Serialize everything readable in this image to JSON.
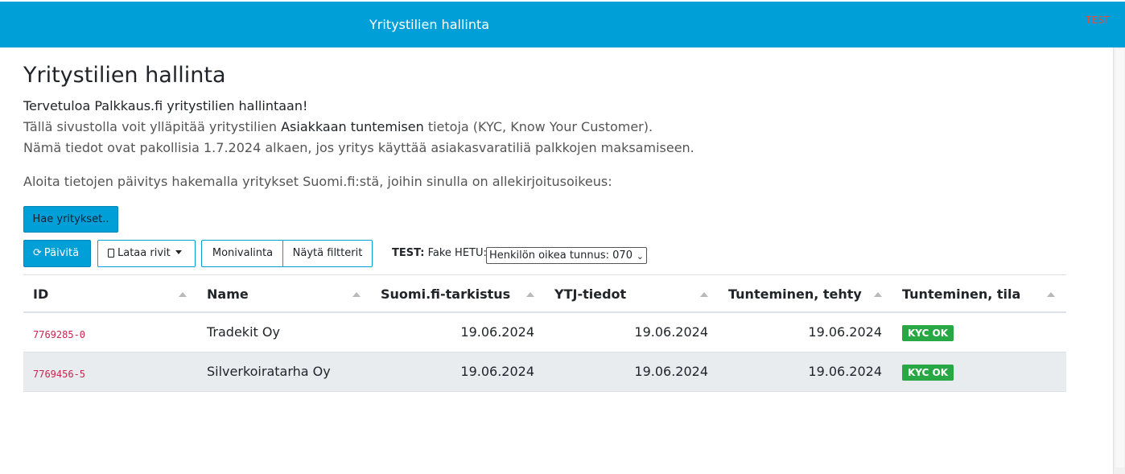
{
  "header": {
    "title": "Yritystilien hallinta",
    "test_label": "TEST"
  },
  "main": {
    "heading": "Yritystilien hallinta",
    "welcome": "Tervetuloa Palkkaus.fi yritystilien hallintaan!",
    "line1_before": "Tällä sivustolla voit ylläpitää yritystilien ",
    "line1_strong": "Asiakkaan tuntemisen",
    "line1_after": " tietoja (KYC, Know Your Customer).",
    "line2": "Nämä tiedot ovat pakollisia 1.7.2024 alkaen, jos yritys käyttää asiakasvaratiliä palkkojen maksamiseen.",
    "line3": "Aloita tietojen päivitys hakemalla yritykset Suomi.fi:stä, joihin sinulla on allekirjoitusoikeus:"
  },
  "toolbar": {
    "search_button": "Hae yritykset..",
    "refresh_button": "Päivitä",
    "download_button": "Lataa rivit",
    "multiselect_button": "Monivalinta",
    "filters_button": "Näytä filtterit",
    "fake_hetu_prefix": "TEST:",
    "fake_hetu_label": "Fake HETU:",
    "fake_hetu_selected": "Henkilön oikea tunnus: 070"
  },
  "table": {
    "columns": [
      "ID",
      "Name",
      "Suomi.fi-tarkistus",
      "YTJ-tiedot",
      "Tunteminen, tehty",
      "Tunteminen, tila"
    ],
    "rows": [
      {
        "id": "7769285-0",
        "name": "Tradekit Oy",
        "suomifi": "19.06.2024",
        "ytj": "19.06.2024",
        "tehty": "19.06.2024",
        "tila": "KYC OK"
      },
      {
        "id": "7769456-5",
        "name": "Silverkoiratarha Oy",
        "suomifi": "19.06.2024",
        "ytj": "19.06.2024",
        "tehty": "19.06.2024",
        "tila": "KYC OK"
      }
    ]
  },
  "colors": {
    "header_blue": "#009fd8",
    "kyc_green": "#28a745",
    "id_pink": "#c7254e",
    "test_red": "#e74c3c"
  },
  "icons": {
    "refresh": "refresh-icon",
    "download": "file-icon",
    "dropdown": "caret-down-icon",
    "sort": "sort-up-icon"
  }
}
